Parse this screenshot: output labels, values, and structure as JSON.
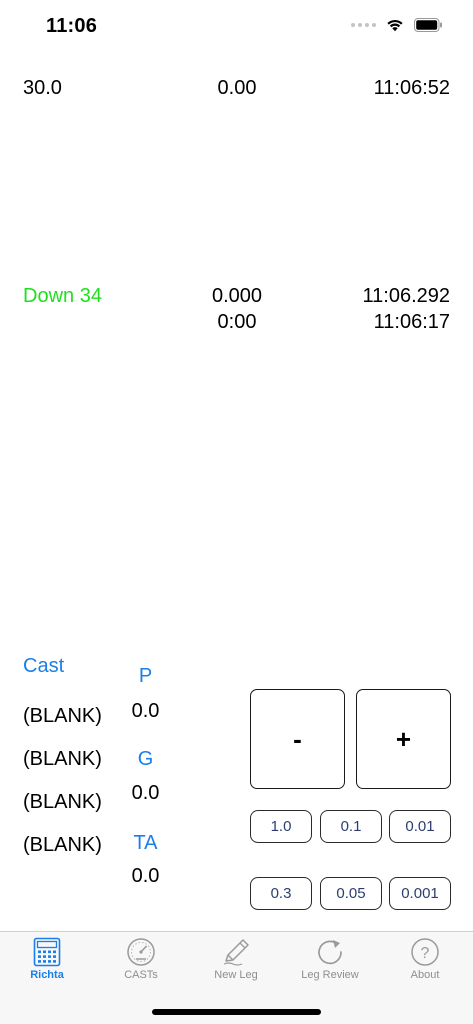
{
  "status": {
    "time": "11:06"
  },
  "top": {
    "left": "30.0",
    "center": "0.00",
    "right": "11:06:52"
  },
  "middle": {
    "label": "Down 34",
    "center_line1": "0.000",
    "center_line2": "0:00",
    "right_line1": "11:06.292",
    "right_line2": "11:06:17"
  },
  "cast": {
    "title": "Cast",
    "items": [
      "(BLANK)",
      "(BLANK)",
      "(BLANK)",
      "(BLANK)"
    ]
  },
  "params": [
    {
      "label": "P",
      "value": "0.0"
    },
    {
      "label": "G",
      "value": "0.0"
    },
    {
      "label": "TA",
      "value": "0.0"
    }
  ],
  "controls": {
    "minus_label": "-",
    "plus_label": "+",
    "steps_row1": [
      "1.0",
      "0.1",
      "0.01"
    ],
    "steps_row2": [
      "0.3",
      "0.05",
      "0.001"
    ]
  },
  "tabs": [
    {
      "label": "Richta",
      "icon": "calculator-icon",
      "active": true
    },
    {
      "label": "CASTs",
      "icon": "gauge-icon",
      "active": false
    },
    {
      "label": "New Leg",
      "icon": "pencil-icon",
      "active": false
    },
    {
      "label": "Leg Review",
      "icon": "refresh-icon",
      "active": false
    },
    {
      "label": "About",
      "icon": "question-icon",
      "active": false
    }
  ],
  "colors": {
    "accent": "#1a7fe8",
    "green": "#1fe01f",
    "inactive": "#8e8e93"
  }
}
